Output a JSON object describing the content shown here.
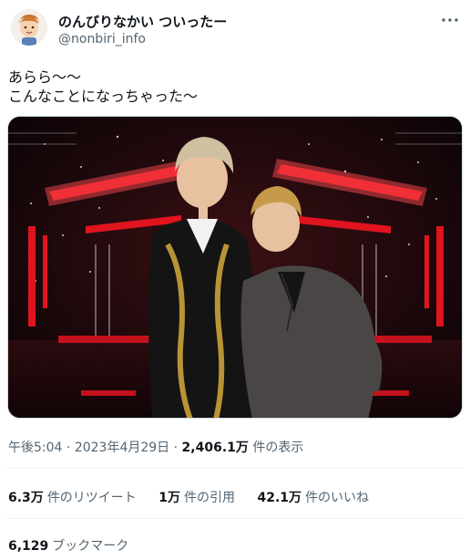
{
  "author": {
    "display_name": "のんびりなかい ついったー",
    "handle": "@nonbiri_info",
    "avatar_icon": "cartoon-avatar-icon"
  },
  "tweet": {
    "line1": "あらら〜〜",
    "line2": "こんなことになっちゃった〜"
  },
  "meta": {
    "time": "午後5:04",
    "separator1": "·",
    "date": "2023年4月29日",
    "separator2": "·",
    "views_value": "2,406.1万",
    "views_label": "件の表示"
  },
  "stats": {
    "retweets_value": "6.3万",
    "retweets_label": "件のリツイート",
    "quotes_value": "1万",
    "quotes_label": "件の引用",
    "likes_value": "42.1万",
    "likes_label": "件のいいね"
  },
  "bookmarks": {
    "value": "6,129",
    "label": "ブックマーク"
  },
  "colors": {
    "text": "#0f1419",
    "secondary": "#536471",
    "divider": "#eff3f4",
    "stage_red": "#e0141e"
  }
}
